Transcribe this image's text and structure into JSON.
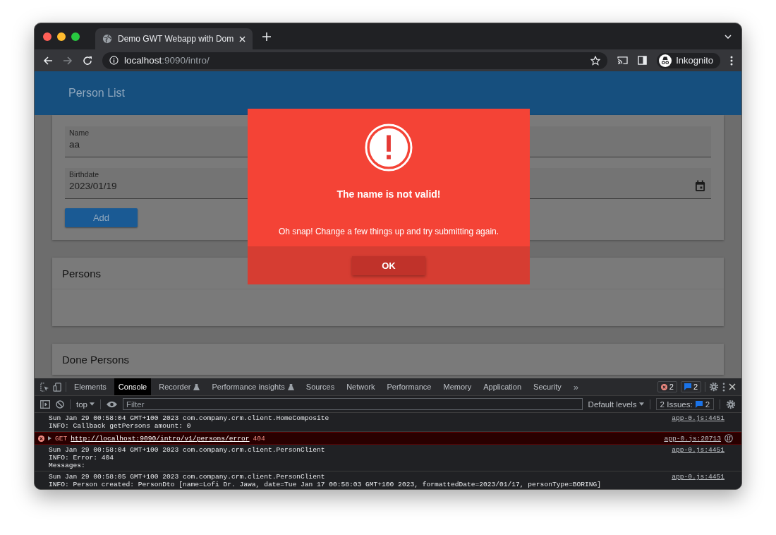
{
  "browser": {
    "tab_title": "Demo GWT Webapp with Dom",
    "url_host": "localhost",
    "url_path": ":9090/intro/",
    "profile": "Inkognito"
  },
  "page": {
    "header_title": "Person List",
    "form": {
      "fields": [
        {
          "label": "Name",
          "value": "aa",
          "kind": "text"
        },
        {
          "label": "Birthdate",
          "value": "2023/01/19",
          "kind": "date"
        }
      ],
      "add_button": "Add"
    },
    "cards": [
      {
        "title": "Persons",
        "kind": "list"
      },
      {
        "title": "Done Persons",
        "kind": "cut"
      }
    ],
    "dialog": {
      "title": "The name is not valid!",
      "message": "Oh snap! Change a few things up and try submitting again.",
      "button": "OK"
    }
  },
  "devtools": {
    "tabs": [
      {
        "label": "Elements",
        "selected": false,
        "experimental": false
      },
      {
        "label": "Console",
        "selected": true,
        "experimental": false
      },
      {
        "label": "Recorder",
        "selected": false,
        "experimental": true
      },
      {
        "label": "Performance insights",
        "selected": false,
        "experimental": true
      },
      {
        "label": "Sources",
        "selected": false,
        "experimental": false
      },
      {
        "label": "Network",
        "selected": false,
        "experimental": false
      },
      {
        "label": "Performance",
        "selected": false,
        "experimental": false
      },
      {
        "label": "Memory",
        "selected": false,
        "experimental": false
      },
      {
        "label": "Application",
        "selected": false,
        "experimental": false
      },
      {
        "label": "Security",
        "selected": false,
        "experimental": false
      }
    ],
    "more": "»",
    "error_count": "2",
    "message_count": "2",
    "console": {
      "context": "top",
      "filter_placeholder": "Filter",
      "levels": "Default levels",
      "issues_label": "2 Issues:",
      "issues_count": "2",
      "messages": [
        {
          "kind": "info",
          "lines": [
            "Sun Jan 29 00:58:04 GMT+100 2023 com.company.crm.client.HomeComposite",
            "INFO: Callback getPersons amount: 0"
          ],
          "source": "app-0.js:4451"
        },
        {
          "kind": "error",
          "method": "GET",
          "url": "http://localhost:9090/intro/v1/persons/error",
          "status": "404",
          "source": "app-0.js:20713"
        },
        {
          "kind": "info",
          "lines": [
            "Sun Jan 29 00:58:04 GMT+100 2023 com.company.crm.client.PersonClient",
            "INFO: Error: 404",
            "Messages:"
          ],
          "source": "app-0.js:4451"
        },
        {
          "kind": "info",
          "lines": [
            "Sun Jan 29 00:58:05 GMT+100 2023 com.company.crm.client.PersonClient",
            "INFO: Person created: PersonDto [name=Lofi Dr. Jawa, date=Tue Jan 17 00:58:03 GMT+100 2023, formattedDate=2023/01/17, personType=BORING]"
          ],
          "source": "app-0.js:4451"
        }
      ]
    }
  }
}
